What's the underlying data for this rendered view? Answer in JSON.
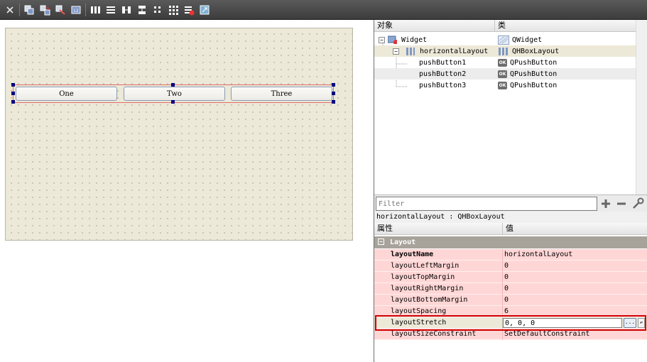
{
  "toolbar": {
    "icons": [
      "close-icon",
      "edit-widgets-icon",
      "edit-signals-icon",
      "edit-buddies-icon",
      "edit-tab-order-icon",
      "layout-horizontal-icon",
      "layout-vertical-icon",
      "layout-splitter-h-icon",
      "layout-splitter-v-icon",
      "layout-form-icon",
      "layout-grid-icon",
      "break-layout-icon",
      "adjust-size-icon"
    ]
  },
  "canvas": {
    "buttons": [
      "One",
      "Two",
      "Three"
    ]
  },
  "object_inspector": {
    "col_object": "对象",
    "col_class": "类",
    "rows": [
      {
        "name": "Widget",
        "cls": "QWidget"
      },
      {
        "name": "horizontalLayout",
        "cls": "QHBoxLayout"
      },
      {
        "name": "pushButton1",
        "cls": "QPushButton"
      },
      {
        "name": "pushButton2",
        "cls": "QPushButton"
      },
      {
        "name": "pushButton3",
        "cls": "QPushButton"
      }
    ]
  },
  "property_editor": {
    "filter_placeholder": "Filter",
    "object_label": "horizontalLayout : QHBoxLayout",
    "col_property": "属性",
    "col_value": "值",
    "group": "Layout",
    "rows": [
      {
        "name": "layoutName",
        "value": "horizontalLayout"
      },
      {
        "name": "layoutLeftMargin",
        "value": "0"
      },
      {
        "name": "layoutTopMargin",
        "value": "0"
      },
      {
        "name": "layoutRightMargin",
        "value": "0"
      },
      {
        "name": "layoutBottomMargin",
        "value": "0"
      },
      {
        "name": "layoutSpacing",
        "value": "6"
      },
      {
        "name": "layoutStretch",
        "value": "0, 0, 0"
      },
      {
        "name": "layoutSizeConstraint",
        "value": "SetDefaultConstraint"
      }
    ],
    "highlight_color": "#d00000"
  }
}
